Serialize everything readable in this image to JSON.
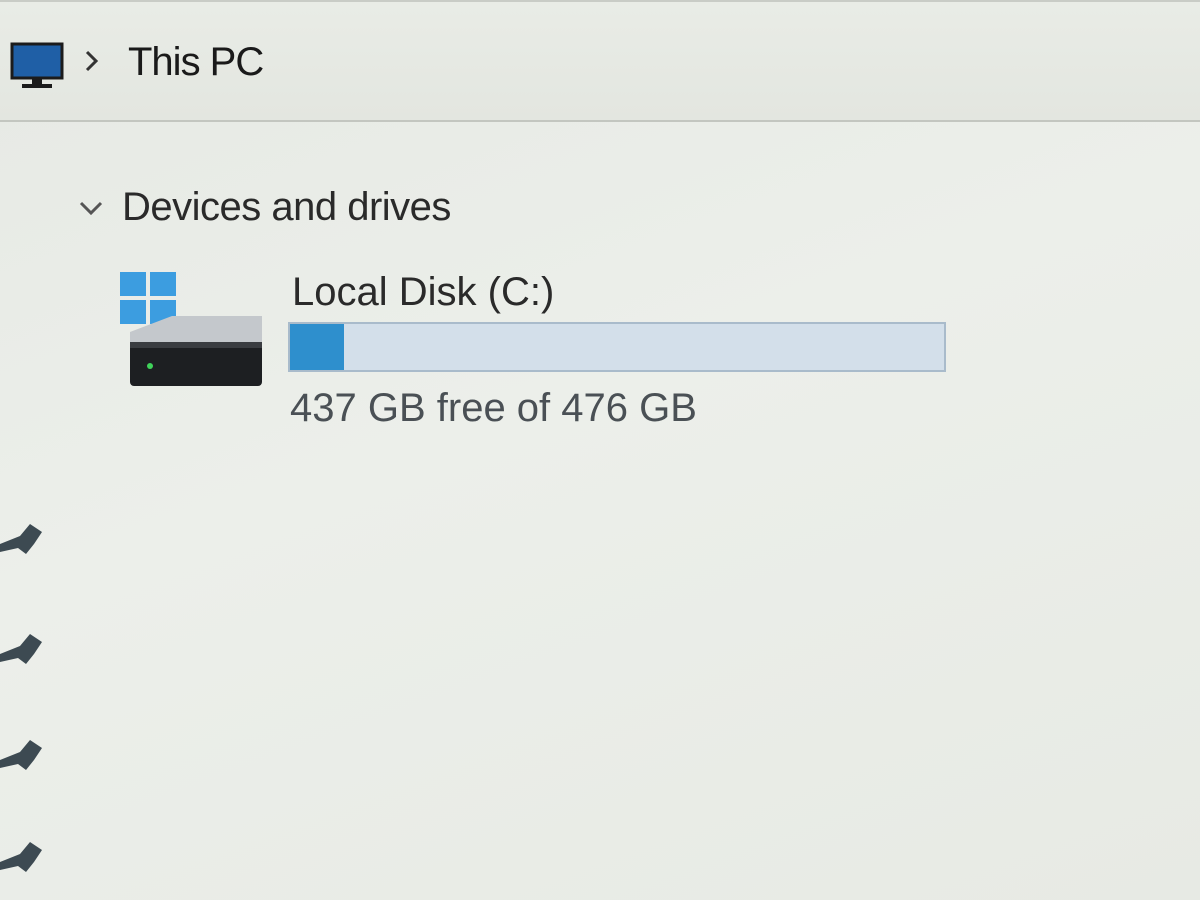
{
  "address_bar": {
    "location_icon": "monitor-icon",
    "separator_icon": "chevron-right-icon",
    "breadcrumb": "This PC"
  },
  "section": {
    "toggle_icon": "chevron-down-icon",
    "title": "Devices and drives"
  },
  "drive": {
    "icon": "windows-drive-icon",
    "name": "Local Disk (C:)",
    "free_text": "437 GB free of 476 GB",
    "used_fraction": 0.082,
    "bar_color": "#2e8fcd",
    "bar_track_color": "#d3dfea"
  },
  "quick_access_pins": [
    "pin-icon",
    "pin-icon",
    "pin-icon",
    "pin-icon"
  ],
  "colors": {
    "background": "#e9ece7",
    "text": "#222222",
    "accent": "#2e8fcd"
  }
}
